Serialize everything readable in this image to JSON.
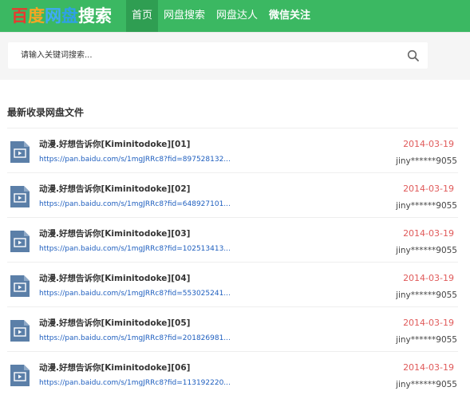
{
  "header": {
    "logo_chars": [
      "百",
      "度",
      "网",
      "盘",
      "搜",
      "索"
    ],
    "nav": [
      {
        "label": "首页",
        "active": true
      },
      {
        "label": "网盘搜索",
        "active": false
      },
      {
        "label": "网盘达人",
        "active": false
      },
      {
        "label": "微信关注",
        "active": false
      }
    ]
  },
  "search": {
    "placeholder": "请输入关键词搜索...",
    "icon": "search-icon"
  },
  "main": {
    "section_title": "最新收录网盘文件",
    "files": [
      {
        "name": "动漫.好想告诉你[Kiminitodoke][01]",
        "link": "https://pan.baidu.com/s/1mgJRRc8?fid=897528132...",
        "date": "2014-03-19",
        "user": "jiny******9055"
      },
      {
        "name": "动漫.好想告诉你[Kiminitodoke][02]",
        "link": "https://pan.baidu.com/s/1mgJRRc8?fid=648927101...",
        "date": "2014-03-19",
        "user": "jiny******9055"
      },
      {
        "name": "动漫.好想告诉你[Kiminitodoke][03]",
        "link": "https://pan.baidu.com/s/1mgJRRc8?fid=102513413...",
        "date": "2014-03-19",
        "user": "jiny******9055"
      },
      {
        "name": "动漫.好想告诉你[Kiminitodoke][04]",
        "link": "https://pan.baidu.com/s/1mgJRRc8?fid=553025241...",
        "date": "2014-03-19",
        "user": "jiny******9055"
      },
      {
        "name": "动漫.好想告诉你[Kiminitodoke][05]",
        "link": "https://pan.baidu.com/s/1mgJRRc8?fid=201826981...",
        "date": "2014-03-19",
        "user": "jiny******9055"
      },
      {
        "name": "动漫.好想告诉你[Kiminitodoke][06]",
        "link": "https://pan.baidu.com/s/1mgJRRc8?fid=113192220...",
        "date": "2014-03-19",
        "user": "jiny******9055"
      }
    ],
    "file_icon": "video-file-icon"
  },
  "colors": {
    "header_bg": "#3bb862",
    "nav_active_bg": "#2f9e52",
    "date": "#e05a5a",
    "link": "#1f5fbf"
  }
}
